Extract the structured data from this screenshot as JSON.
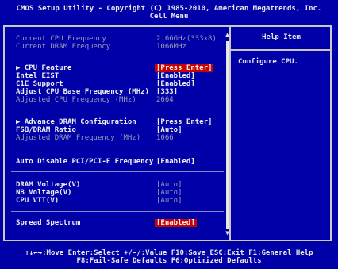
{
  "header": {
    "title": "CMOS Setup Utility - Copyright (C) 1985-2010, American Megatrends, Inc.",
    "subtitle": "Cell Menu"
  },
  "colors": {
    "background": "#0000a8",
    "highlight": "#c80000",
    "text": "#c8c8c8"
  },
  "settings": [
    {
      "label": "Current CPU Frequency",
      "value": "2.66GHz(333x8)"
    },
    {
      "label": "Current DRAM Frequency",
      "value": "1066MHz"
    },
    {
      "label": "▶ CPU Feature",
      "value": "[Press Enter]"
    },
    {
      "label": "Intel EIST",
      "value": "[Enabled]"
    },
    {
      "label": "C1E Support",
      "value": "[Enabled]"
    },
    {
      "label": "Adjust CPU Base Frequency (MHz)",
      "value": "[333]"
    },
    {
      "label": "Adjusted CPU Frequency (MHz)",
      "value": "2664"
    },
    {
      "label": "▶ Advance DRAM Configuration",
      "value": "[Press Enter]"
    },
    {
      "label": "FSB/DRAM Ratio",
      "value": "[Auto]"
    },
    {
      "label": "Adjusted DRAM Frequency (MHz)",
      "value": "1066"
    },
    {
      "label": "Auto Disable PCI/PCI-E Frequency",
      "value": "[Enabled]"
    },
    {
      "label": "DRAM Voltage(V)",
      "value": "[Auto]"
    },
    {
      "label": "NB Voltage(V)",
      "value": "[Auto]"
    },
    {
      "label": "CPU VTT(V)",
      "value": "[Auto]"
    },
    {
      "label": "Spread Spectrum",
      "value": "[Enabled]"
    }
  ],
  "scrollbar": {
    "up_icon": "▲",
    "down_icon": "▼"
  },
  "help": {
    "title": "Help Item",
    "text": "Configure CPU."
  },
  "footer": {
    "line1": "↑↓←→:Move  Enter:Select  +/-/:Value  F10:Save  ESC:Exit  F1:General Help",
    "line2": "F8:Fail-Safe Defaults  F6:Optimized Defaults"
  }
}
